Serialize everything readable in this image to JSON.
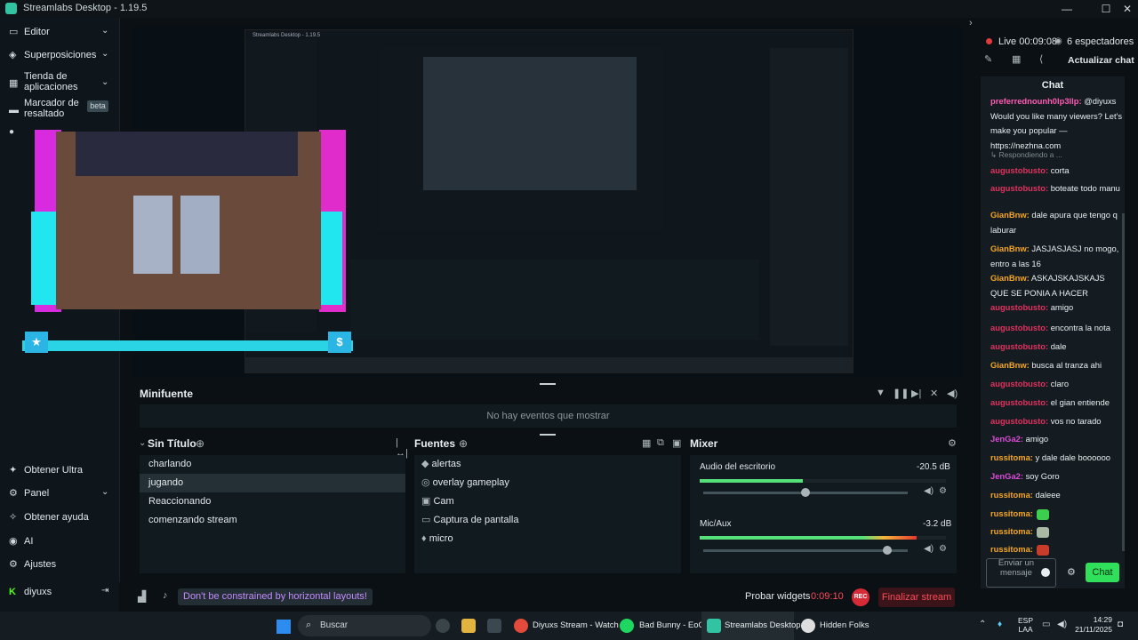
{
  "titlebar": {
    "title": "Streamlabs Desktop - 1.19.5"
  },
  "nav": {
    "items": [
      {
        "label": "Editor",
        "icon": "editor-icon"
      },
      {
        "label": "Superposiciones",
        "icon": "overlays-icon"
      },
      {
        "label": "Tienda de aplicaciones",
        "icon": "app-store-icon"
      },
      {
        "label": "Marcador de resaltado",
        "icon": "highlighter-icon",
        "badge": "beta"
      }
    ],
    "bottom": [
      {
        "label": "Obtener Ultra",
        "icon": "ultra-icon"
      },
      {
        "label": "Panel",
        "icon": "dashboard-icon"
      },
      {
        "label": "Obtener ayuda",
        "icon": "help-icon"
      },
      {
        "label": "AI",
        "icon": "ai-icon"
      },
      {
        "label": "Ajustes",
        "icon": "settings-icon"
      },
      {
        "label": "diyuxs",
        "icon": "user-icon"
      }
    ]
  },
  "minifeed": {
    "title": "Minifuente",
    "empty": "No hay eventos que mostrar"
  },
  "scenes": {
    "title": "Sin Título",
    "items": [
      "charlando",
      "jugando",
      "Reaccionando",
      "comenzando stream"
    ],
    "selected": "jugando"
  },
  "sources": {
    "title": "Fuentes",
    "items": [
      {
        "label": "alertas",
        "icon": "alert-icon"
      },
      {
        "label": "overlay gameplay",
        "icon": "globe-icon"
      },
      {
        "label": "Cam",
        "icon": "camera-icon"
      },
      {
        "label": "Captura de pantalla",
        "icon": "monitor-icon"
      },
      {
        "label": "micro",
        "icon": "mic-icon"
      }
    ]
  },
  "mixer": {
    "title": "Mixer",
    "channels": [
      {
        "name": "Audio del escritorio",
        "db": "-20.5 dB",
        "level": 0.42,
        "volume": 0.5
      },
      {
        "name": "Mic/Aux",
        "db": "-3.2 dB",
        "level": 0.88,
        "volume": 0.9
      }
    ]
  },
  "footer": {
    "tip": "Don't be constrained by horizontal layouts!",
    "probar": "Probar widgets",
    "timer": "0:09:10",
    "rec": "REC",
    "end": "Finalizar stream"
  },
  "status": {
    "live": "Live 00:09:08",
    "viewers": "6 espectadores",
    "refresh": "Actualizar chat"
  },
  "chat": {
    "title": "Chat",
    "messages": [
      {
        "user": "preferrednounh0lp3llp:",
        "text": " @diyuxs Would you like many viewers? Let's make you popular — https://nezhna.com",
        "color": "#ff5ab5"
      },
      {
        "user": "",
        "text": "↳ Respondiendo a ...",
        "color": "#7e8a90",
        "reply": true
      },
      {
        "user": "augustobusto:",
        "text": " corta",
        "color": "#e0325f"
      },
      {
        "user": "augustobusto:",
        "text": " boteate todo manu",
        "color": "#e0325f"
      },
      {
        "user": "GianBnw:",
        "text": " dale apura que tengo q laburar",
        "color": "#f5a623"
      },
      {
        "user": "GianBnw:",
        "text": " JASJASJASJ no mogo, entro a las 16",
        "color": "#f5a623"
      },
      {
        "user": "GianBnw:",
        "text": " ASKAJSKAJSKAJS QUE SE PONIA A HACER",
        "color": "#f5a623"
      },
      {
        "user": "augustobusto:",
        "text": " amigo",
        "color": "#e0325f"
      },
      {
        "user": "augustobusto:",
        "text": " encontra la nota",
        "color": "#e0325f"
      },
      {
        "user": "augustobusto:",
        "text": " dale",
        "color": "#e0325f"
      },
      {
        "user": "GianBnw:",
        "text": " busca al tranza ahi",
        "color": "#f5a623"
      },
      {
        "user": "augustobusto:",
        "text": " claro",
        "color": "#e0325f"
      },
      {
        "user": "augustobusto:",
        "text": " el gian entiende",
        "color": "#e0325f"
      },
      {
        "user": "augustobusto:",
        "text": " vos no tarado",
        "color": "#e0325f"
      },
      {
        "user": "JenGa2:",
        "text": " amigo",
        "color": "#d94bd6"
      },
      {
        "user": "russitoma:",
        "text": " y dale dale boooooo",
        "color": "#f5a623"
      },
      {
        "user": "JenGa2:",
        "text": " soy Goro",
        "color": "#d94bd6"
      },
      {
        "user": "russitoma:",
        "text": " daleee",
        "color": "#f5a623"
      },
      {
        "user": "russitoma:",
        "text": "",
        "color": "#f5a623",
        "emote": "#3ccf4e"
      },
      {
        "user": "russitoma:",
        "text": "",
        "color": "#f5a623",
        "emote": "#a9b9a6"
      },
      {
        "user": "russitoma:",
        "text": "",
        "color": "#f5a623",
        "emote": "#c93b2b"
      }
    ],
    "input_placeholder": "Enviar un mensaje",
    "send": "Chat"
  },
  "taskbar": {
    "search": "Buscar",
    "apps": [
      {
        "label": "Diyuxs Stream - Watch I",
        "color": "#e24a3b"
      },
      {
        "label": "Bad Bunny - EoO",
        "color": "#1ed760"
      },
      {
        "label": "Streamlabs Desktop",
        "color": "#31c3a2"
      },
      {
        "label": "Hidden Folks",
        "color": "#dddddd"
      }
    ],
    "lang": "ESP",
    "lang2": "LAA",
    "time": "14:29",
    "date": "21/11/2025"
  },
  "nested": {
    "title": "Streamlabs Desktop - 1.19.5"
  }
}
